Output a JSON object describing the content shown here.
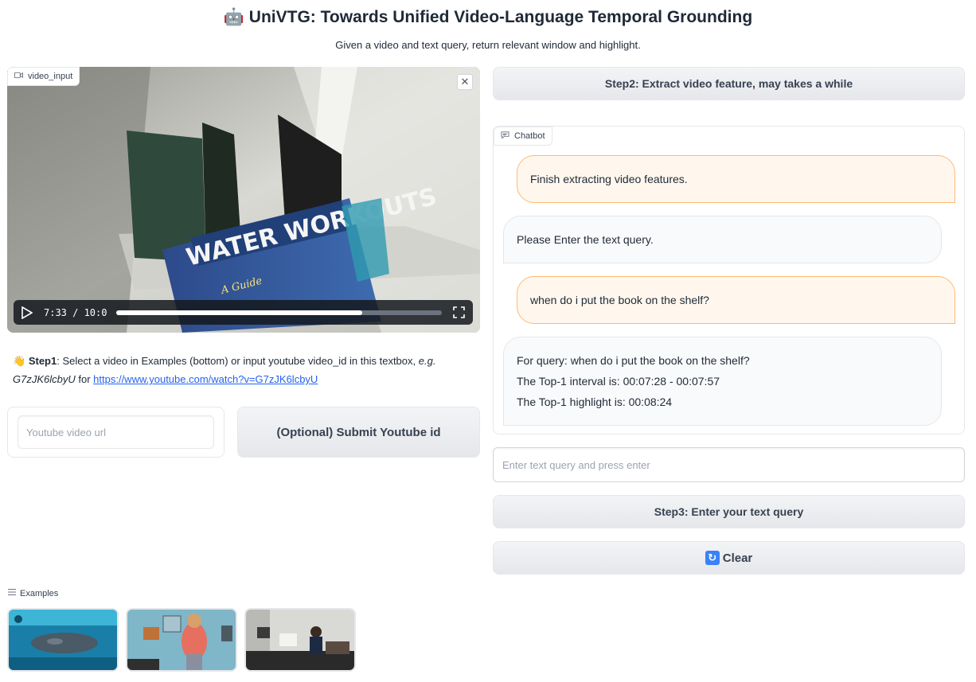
{
  "header": {
    "title": "🤖 UniVTG: Towards Unified Video-Language Temporal Grounding",
    "subtitle": "Given a video and text query, return relevant window and highlight."
  },
  "video": {
    "label": "video_input",
    "book_text": "WATER WORKOUTS",
    "book_subtext": "A Guide",
    "time": "7:33 / 10:0",
    "progress_fraction": 0.755
  },
  "step1": {
    "emoji": "👋",
    "bold": "Step1",
    "text": ": Select a video in Examples (bottom) or input youtube video_id in this textbox, ",
    "eg": "e.g.",
    "id_example": "G7zJK6lcbyU",
    "for": " for ",
    "link": "https://www.youtube.com/watch?v=G7zJK6lcbyU"
  },
  "youtube": {
    "placeholder": "Youtube video url",
    "submit_label": "(Optional) Submit Youtube id"
  },
  "step2_label": "Step2: Extract video feature, may takes a while",
  "chatbot": {
    "label": "Chatbot",
    "messages": [
      {
        "role": "user",
        "lines": [
          "Finish extracting video features."
        ]
      },
      {
        "role": "bot",
        "lines": [
          "Please Enter the text query."
        ]
      },
      {
        "role": "user",
        "lines": [
          "when do i put the book on the shelf?"
        ]
      },
      {
        "role": "bot",
        "lines": [
          "For query: when do i put the book on the shelf?",
          "The Top-1 interval is: 00:07:28 - 00:07:57",
          "The Top-1 highlight is: 00:08:24"
        ]
      }
    ]
  },
  "query": {
    "placeholder": "Enter text query and press enter"
  },
  "step3_label": "Step3: Enter your text query",
  "clear": {
    "icon": "🔃",
    "label": "Clear"
  },
  "examples": {
    "label": "Examples"
  },
  "colors": {
    "user_bubble": "#fff7ed",
    "user_border": "#fdba74",
    "link": "#2563eb"
  }
}
